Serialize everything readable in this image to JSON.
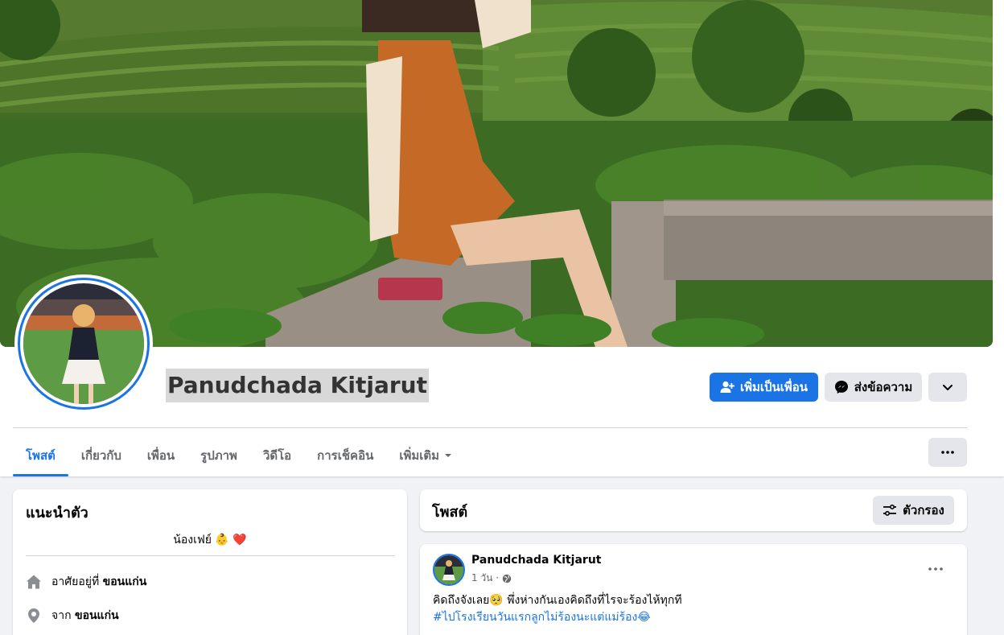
{
  "profile": {
    "name": "Panudchada Kitjarut",
    "cover_alt": "cover photo",
    "avatar_alt": "profile picture"
  },
  "actions": {
    "add_friend": "เพิ่มเป็นเพื่อน",
    "message": "ส่งข้อความ"
  },
  "tabs": [
    {
      "label": "โพสต์"
    },
    {
      "label": "เกี่ยวกับ"
    },
    {
      "label": "เพื่อน"
    },
    {
      "label": "รูปภาพ"
    },
    {
      "label": "วิดีโอ"
    },
    {
      "label": "การเช็คอิน"
    },
    {
      "label": "เพิ่มเติม"
    }
  ],
  "intro": {
    "title": "แนะนำตัว",
    "bio": "น้องเฟย์ 👶 ❤️",
    "lives_prefix": "อาศัยอยู่ที่",
    "lives_value": "ขอนแก่น",
    "from_prefix": "จาก",
    "from_value": "ขอนแก่น"
  },
  "posts": {
    "title": "โพสต์",
    "filter_label": "ตัวกรอง"
  },
  "post": {
    "author": "Panudchada Kitjarut",
    "time": "1 วัน ·",
    "text": "คิดถึงจังเลย🥺 พึ่งห่างกันเองคิดถึงที่ไรจะร้องไห้ทุกที",
    "hashtag": "#ไปโรงเรียนวันแรกลูกไม่ร้องนะแต่แม่ร้อง😂"
  },
  "colors": {
    "accent": "#1b74e4",
    "background": "#f0f2f5",
    "secondary_button": "#e4e6eb",
    "muted_text": "#65676b"
  },
  "icons": {
    "add_friend": "add-friend-icon",
    "message": "messenger-icon",
    "dropdown": "chevron-down-icon",
    "more": "more-dots-icon",
    "home": "home-icon",
    "location": "location-pin-icon",
    "filter": "filter-icon",
    "public": "globe-icon"
  }
}
